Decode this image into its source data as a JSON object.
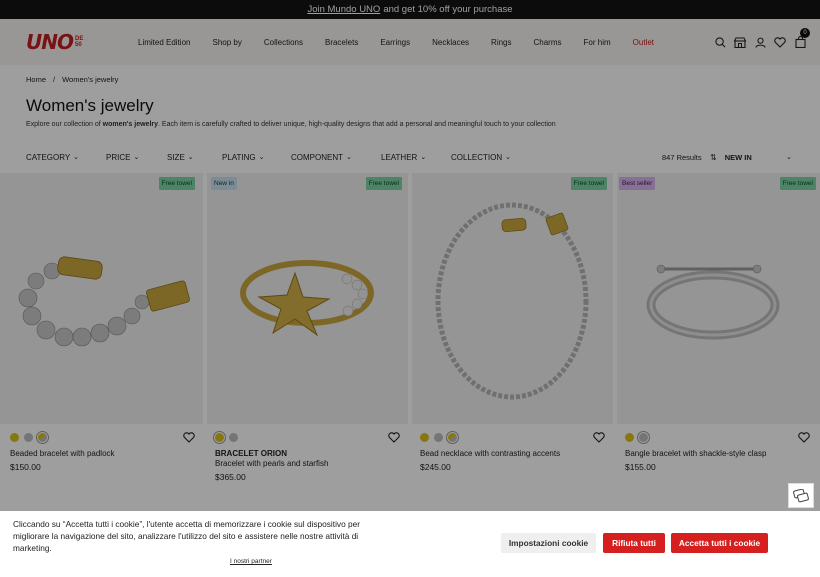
{
  "promo": {
    "link": "Join Mundo UNO",
    "text": "and get 10% off your purchase"
  },
  "brand": {
    "logo": "UNO",
    "logo_small_1": "DE",
    "logo_small_2": "50"
  },
  "nav": [
    "Limited Edition",
    "Shop by",
    "Collections",
    "Bracelets",
    "Earrings",
    "Necklaces",
    "Rings",
    "Charms",
    "For him",
    "Outlet"
  ],
  "cart_count": "0",
  "breadcrumb": {
    "home": "Home",
    "sep": "/",
    "current": "Women's jewelry"
  },
  "page_title": "Women's jewelry",
  "intro": {
    "before": "Explore our collection of ",
    "bold": "women's jewelry",
    "after": ". Each item is carefully crafted to deliver unique, high-quality designs that add a personal and meaningful touch to your collection"
  },
  "filters": [
    "CATEGORY",
    "PRICE",
    "SIZE",
    "PLATING",
    "COMPONENT",
    "LEATHER",
    "COLLECTION"
  ],
  "results": "847 Results",
  "sort_label": "NEW IN",
  "products": [
    {
      "badges": [
        {
          "text": "Free towel",
          "color": "green",
          "pos": "right"
        }
      ],
      "swatches": [
        "gold",
        "silver",
        "mix"
      ],
      "strong": "",
      "name": "Beaded bracelet with padlock",
      "price": "$150.00"
    },
    {
      "badges": [
        {
          "text": "New in",
          "color": "blue",
          "pos": "left"
        },
        {
          "text": "Free towel",
          "color": "green",
          "pos": "right"
        }
      ],
      "swatches": [
        "gold",
        "silver"
      ],
      "strong": "BRACELET ORION",
      "name": "Bracelet with pearls and starfish",
      "price": "$365.00"
    },
    {
      "badges": [
        {
          "text": "Free towel",
          "color": "green",
          "pos": "right"
        }
      ],
      "swatches": [
        "gold",
        "silver",
        "mix"
      ],
      "strong": "",
      "name": "Bead necklace with contrasting accents",
      "price": "$245.00"
    },
    {
      "badges": [
        {
          "text": "Best seller",
          "color": "purple",
          "pos": "left"
        },
        {
          "text": "Free towel",
          "color": "green",
          "pos": "right"
        }
      ],
      "swatches": [
        "gold",
        "silver"
      ],
      "strong": "",
      "name": "Bangle bracelet with shackle-style clasp",
      "price": "$155.00"
    }
  ],
  "cookie": {
    "text": "Cliccando su “Accetta tutti i cookie”, l'utente accetta di memorizzare i cookie sul dispositivo per migliorare la navigazione del sito, analizzare l'utilizzo del sito e assistere nelle nostre attività di marketing.",
    "partners": "I nostri partner",
    "settings": "Impostazioni cookie",
    "reject": "Rifiuta tutti",
    "accept": "Accetta tutti i cookie"
  },
  "colors": {
    "brand_red": "#c41e1e",
    "button_red": "#d62020",
    "badge_green": "#7fd6a5"
  }
}
